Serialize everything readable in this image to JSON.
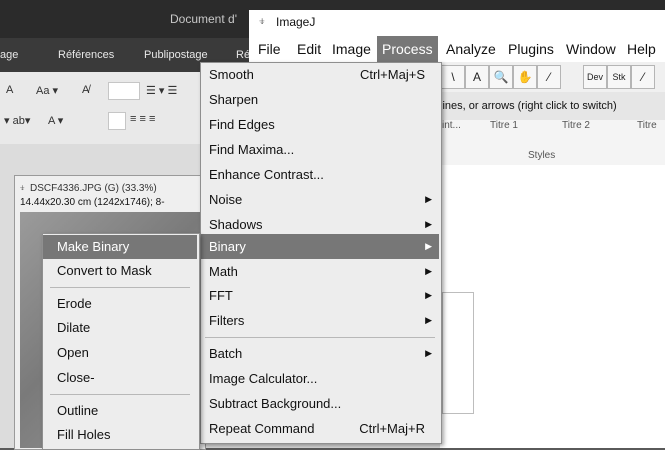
{
  "word": {
    "doc_title": "Document d'",
    "tabs": [
      "age",
      "Références",
      "Publipostage",
      "Ré"
    ],
    "ribbon": {
      "row1": [
        "A",
        "Aa ▾",
        "A̸"
      ],
      "row2": [
        "▾ ab▾",
        "A ▾"
      ],
      "styles_heads": [
        "int...",
        "Titre 1",
        "Titre 2",
        "Titre"
      ],
      "styles_label": "Styles"
    }
  },
  "image_window": {
    "title": "DSCF4336.JPG (G) (33.3%)",
    "info": "14.44x20.30 cm (1242x1746); 8-"
  },
  "imagej": {
    "title": "ImageJ",
    "menus": [
      "File",
      "Edit",
      "Image",
      "Process",
      "Analyze",
      "Plugins",
      "Window",
      "Help"
    ],
    "active_menu": "Process",
    "status_text": "lines, or arrows (right click to switch)",
    "tools": [
      "\\",
      "A",
      "🔍",
      "✋",
      "⁄",
      "Dev",
      "Stk",
      "⁄"
    ]
  },
  "process_menu": {
    "items": [
      {
        "label": "Smooth",
        "shortcut": "Ctrl+Maj+S"
      },
      {
        "label": "Sharpen"
      },
      {
        "label": "Find Edges"
      },
      {
        "label": "Find Maxima..."
      },
      {
        "label": "Enhance Contrast..."
      },
      {
        "label": "Noise",
        "submenu": true
      },
      {
        "label": "Shadows",
        "submenu": true
      },
      {
        "label": "Binary",
        "submenu": true,
        "highlighted": true
      },
      {
        "label": "Math",
        "submenu": true
      },
      {
        "label": "FFT",
        "submenu": true
      },
      {
        "label": "Filters",
        "submenu": true
      },
      {
        "label": "Batch",
        "submenu": true
      },
      {
        "label": "Image Calculator..."
      },
      {
        "label": "Subtract Background..."
      },
      {
        "label": "Repeat Command",
        "shortcut": "Ctrl+Maj+R"
      }
    ]
  },
  "binary_menu": {
    "items": [
      {
        "label": "Make Binary",
        "highlighted": true
      },
      {
        "label": "Convert to Mask"
      },
      {
        "label": "Erode"
      },
      {
        "label": "Dilate"
      },
      {
        "label": "Open"
      },
      {
        "label": "Close-"
      },
      {
        "label": "Outline"
      },
      {
        "label": "Fill Holes"
      }
    ]
  }
}
